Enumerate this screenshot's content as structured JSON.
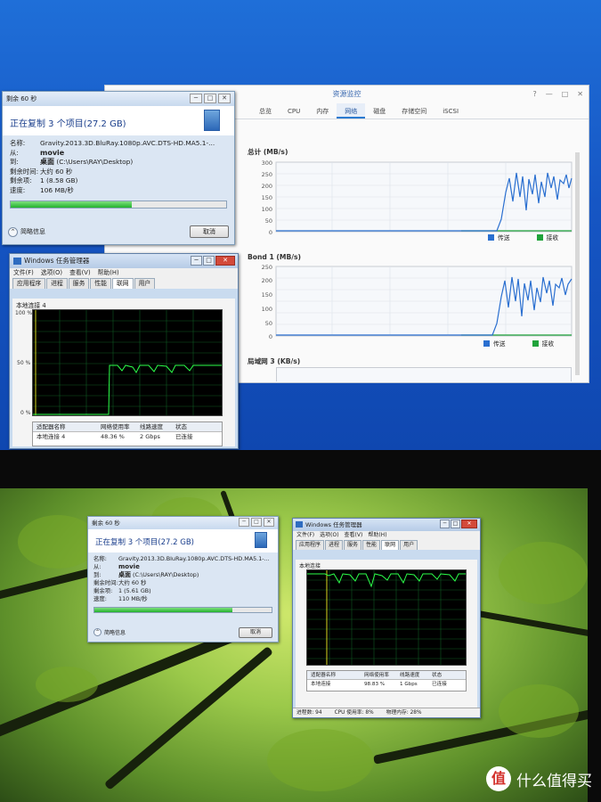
{
  "top": {
    "copy_dialog": {
      "title": "剩余 60 秒",
      "heading": "正在复制 3 个项目(27.2 GB)",
      "labels": {
        "name": "名称:",
        "from": "从:",
        "to": "到:",
        "time_left": "剩余时间:",
        "items_left": "剩余项:",
        "speed": "速度:"
      },
      "values": {
        "name": "Gravity.2013.3D.BluRay.1080p.AVC.DTS-HD.MA5.1-...",
        "from": "movie",
        "to_bold": "桌面",
        "to_path": "(C:\\Users\\RAY\\Desktop)",
        "time_left": "大约 60 秒",
        "items_left": "1 (8.58 GB)",
        "speed": "106 MB/秒"
      },
      "progress": 0.56,
      "more_info": "简略信息",
      "cancel": "取消"
    },
    "task_manager": {
      "title": "Windows 任务管理器",
      "menu": [
        "文件(F)",
        "选项(O)",
        "查看(V)",
        "帮助(H)"
      ],
      "tabs": [
        "应用程序",
        "进程",
        "服务",
        "性能",
        "联网",
        "用户"
      ],
      "active_tab": "联网",
      "conn_label": "本地连接 4",
      "axis": {
        "top": "100 %",
        "mid": "50 %",
        "bottom": "0 %"
      },
      "table_headers": [
        "适配器名称",
        "网络使用率",
        "线路速度",
        "状态"
      ],
      "table_row": [
        "本地连接 4",
        "48.36 %",
        "2 Gbps",
        "已连接"
      ]
    },
    "resource_monitor": {
      "title": "资源监控",
      "window_controls": [
        "?",
        "—",
        "□",
        "✕"
      ],
      "tabs": [
        "总览",
        "CPU",
        "内存",
        "网络",
        "磁盘",
        "存储空间",
        "iSCSI"
      ],
      "active_tab": "网络",
      "panels": [
        {
          "title": "总计 (MB/s)",
          "ticks": [
            "300",
            "250",
            "200",
            "150",
            "100",
            "50",
            "0"
          ],
          "legend": [
            "传送",
            "接收"
          ]
        },
        {
          "title": "Bond 1 (MB/s)",
          "ticks": [
            "250",
            "200",
            "150",
            "100",
            "50",
            "0"
          ],
          "legend": [
            "传送",
            "接收"
          ]
        },
        {
          "title": "局域网 3 (KB/s)"
        }
      ],
      "legend_colors": {
        "send": "#2a6fd0",
        "receive": "#1fa33a"
      }
    }
  },
  "bottom": {
    "copy_dialog": {
      "title": "剩余 60 秒",
      "heading": "正在复制 3 个项目(27.2 GB)",
      "labels": {
        "name": "名称:",
        "from": "从:",
        "to": "到:",
        "time_left": "剩余时间:",
        "items_left": "剩余项:",
        "speed": "速度:"
      },
      "values": {
        "name": "Gravity.2013.3D.BluRay.1080p.AVC.DTS-HD.MA5.1-...",
        "from": "movie",
        "to_bold": "桌面",
        "to_path": "(C:\\Users\\RAY\\Desktop)",
        "time_left": "大约 60 秒",
        "items_left": "1 (5.61 GB)",
        "speed": "110 MB/秒"
      },
      "progress": 0.78,
      "more_info": "简略信息",
      "cancel": "取消"
    },
    "task_manager": {
      "title": "Windows 任务管理器",
      "menu": [
        "文件(F)",
        "选项(O)",
        "查看(V)",
        "帮助(H)"
      ],
      "tabs": [
        "应用程序",
        "进程",
        "服务",
        "性能",
        "联网",
        "用户"
      ],
      "active_tab": "联网",
      "conn_label": "本地连接",
      "table_headers": [
        "适配器名称",
        "网络使用率",
        "线路速度",
        "状态"
      ],
      "table_row": [
        "本地连接",
        "98.83 %",
        "1 Gbps",
        "已连接"
      ],
      "status": [
        "进程数: 94",
        "CPU 使用率: 8%",
        "物理内存: 28%"
      ]
    }
  },
  "watermark": {
    "logo": "值",
    "text": "什么值得买"
  }
}
